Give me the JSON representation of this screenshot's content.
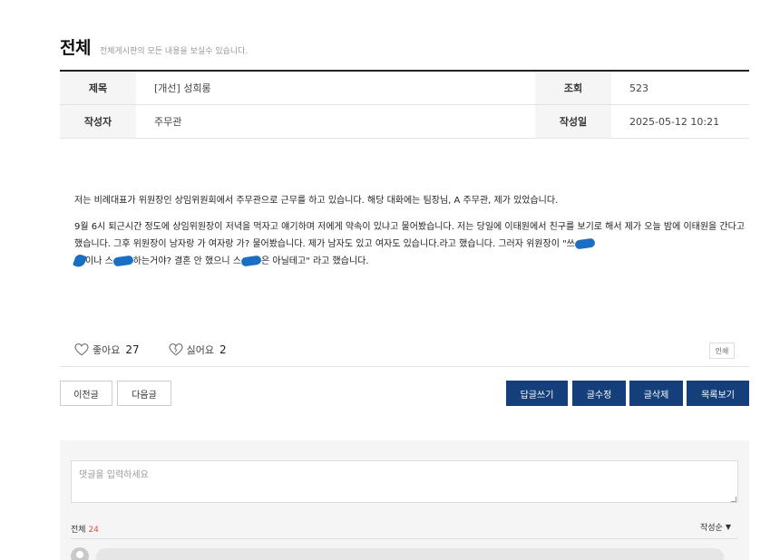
{
  "header": {
    "title": "전체",
    "subtitle": "전체게시판의 모든 내용을 보실수 있습니다."
  },
  "post_info": {
    "title_label": "제목",
    "title_value": "[개선] 성희롱",
    "views_label": "조회",
    "views_value": "523",
    "author_label": "작성자",
    "author_value": "주무관",
    "date_label": "작성일",
    "date_value": "2025-05-12 10:21"
  },
  "content": {
    "paragraph1": "저는 비례대표가 위원장인 상임위원회에서 주무관으로 근무를 하고 있습니다. 해당 대화에는 팀장님, A 주무관, 제가 있었습니다.",
    "p2_part1": "9월 6시 퇴근시간 정도에 상임위원장이 저녁을 먹자고 얘기하며 저에게 약속이 있냐고 물어봤습니다. 저는 당일에 이태원에서 친구를 보기로 해서 제가 오늘 밤에 이태원을 간다고 했습니다. 그후 위원장이 남자랑 가 여자랑 가? 물어봤습니다. 제가 남자도 있고 여자도 있습니다.라고 했습니다. 그러자 위원장이 \"쓰",
    "p2_part2": "이나 스",
    "p2_part3": "하는거야? 결혼 안 했으니 스",
    "p2_part4": "은 아닐테고\" 라고 했습니다."
  },
  "reactions": {
    "like_label": "좋아요",
    "like_count": "27",
    "dislike_label": "싫어요",
    "dislike_count": "2",
    "print_label": "인쇄"
  },
  "nav": {
    "prev_label": "이전글",
    "next_label": "다음글"
  },
  "actions": {
    "reply_label": "답글쓰기",
    "edit_label": "글수정",
    "delete_label": "글삭제",
    "list_label": "목록보기"
  },
  "comments": {
    "placeholder": "댓글을 입력하세요",
    "total_label": "전체",
    "total_count": "24",
    "sort_label": "작성순"
  },
  "colors": {
    "accent": "#143f7a",
    "count_highlight": "#d9534f",
    "redaction": "#1b6fc2"
  }
}
